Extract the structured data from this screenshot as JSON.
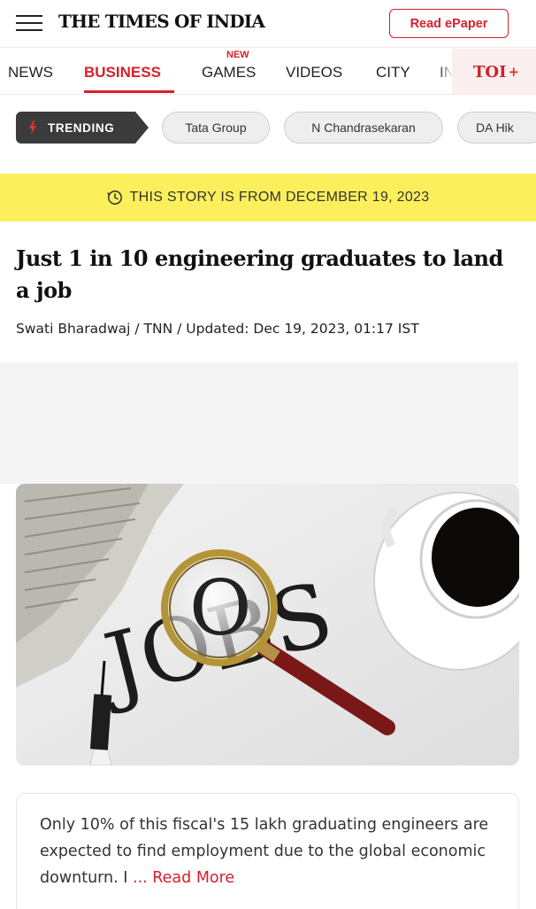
{
  "header": {
    "logo_text": "THE TIMES OF INDIA",
    "epaper_label": "Read ePaper",
    "brand_color": "#d6202c"
  },
  "nav": {
    "items": [
      {
        "label": "NEWS",
        "active": false
      },
      {
        "label": "BUSINESS",
        "active": true
      },
      {
        "label": "GAMES",
        "active": false,
        "badge": "NEW"
      },
      {
        "label": "VIDEOS",
        "active": false
      },
      {
        "label": "CITY",
        "active": false
      },
      {
        "label": "IN",
        "active": false
      }
    ],
    "toi_plus_label": "TOI",
    "toi_plus_mark": "+"
  },
  "trending": {
    "label": "TRENDING",
    "icon": "flame-icon",
    "chips": [
      "Tata Group",
      "N Chandrasekaran",
      "DA Hik"
    ]
  },
  "banner": {
    "icon": "clock-icon",
    "text": "THIS STORY IS FROM DECEMBER 19, 2023",
    "background": "#fbf05b"
  },
  "article": {
    "headline": "Just 1 in 10 engineering graduates to land a job",
    "byline": "Swati Bharadwaj / TNN / Updated: Dec 19, 2023, 01:17 IST",
    "image_text": "JOBS",
    "summary": "Only 10% of this fiscal's 15 lakh graduating engineers are expected to find employment due to the global economic downturn. I",
    "read_more_ellipsis": "... ",
    "read_more_label": "Read More"
  }
}
